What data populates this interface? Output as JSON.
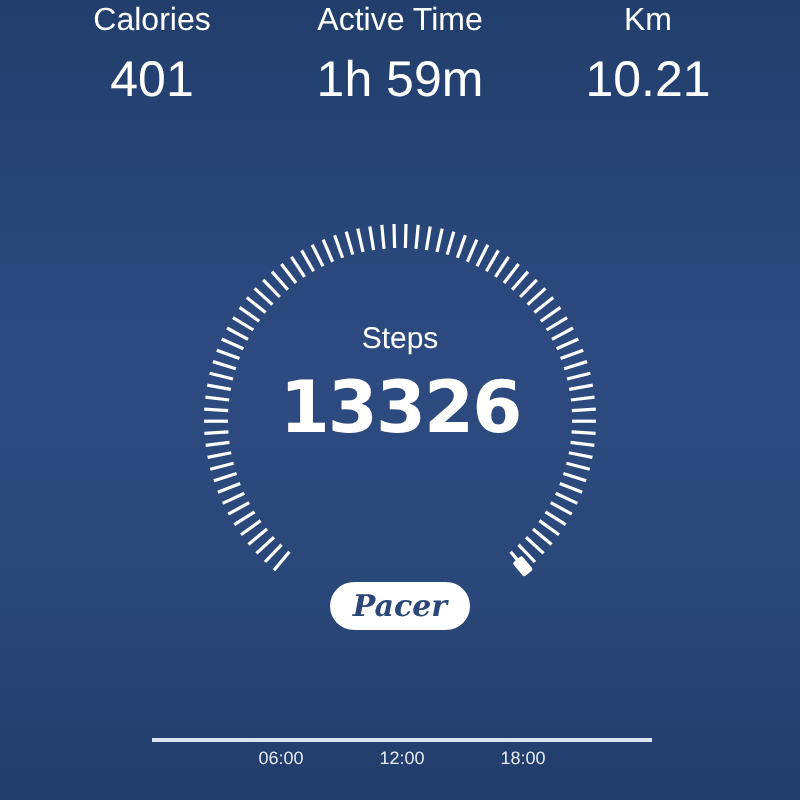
{
  "stats": [
    {
      "label": "Calories",
      "value": "401"
    },
    {
      "label": "Active Time",
      "value": "1h 59m"
    },
    {
      "label": "Km",
      "value": "10.21"
    }
  ],
  "gauge": {
    "label": "Steps",
    "value": "13326"
  },
  "brand": "Pacer",
  "timeline": {
    "ticks": [
      "06:00",
      "12:00",
      "18:00"
    ]
  }
}
